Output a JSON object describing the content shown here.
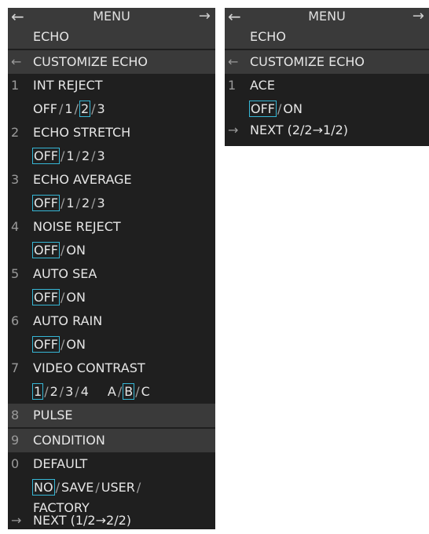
{
  "left": {
    "title": "MENU",
    "back_arrow": "←",
    "forward_arrow": "→",
    "section": "ECHO",
    "sub_back": "←",
    "sub_title": "CUSTOMIZE ECHO",
    "items": [
      {
        "num": "1",
        "label": "INT REJECT"
      },
      {
        "num": "2",
        "label": "ECHO STRETCH"
      },
      {
        "num": "3",
        "label": "ECHO AVERAGE"
      },
      {
        "num": "4",
        "label": "NOISE REJECT"
      },
      {
        "num": "5",
        "label": "AUTO SEA"
      },
      {
        "num": "6",
        "label": "AUTO RAIN"
      },
      {
        "num": "7",
        "label": "VIDEO CONTRAST"
      },
      {
        "num": "8",
        "label": "PULSE"
      },
      {
        "num": "9",
        "label": "CONDITION"
      },
      {
        "num": "0",
        "label": "DEFAULT"
      }
    ],
    "int_reject_options": [
      "OFF",
      "1",
      "2",
      "3"
    ],
    "echo_stretch_options": [
      "OFF",
      "1",
      "2",
      "3"
    ],
    "echo_average_options": [
      "OFF",
      "1",
      "2",
      "3"
    ],
    "noise_reject_options": [
      "OFF",
      "ON"
    ],
    "auto_sea_options": [
      "OFF",
      "ON"
    ],
    "auto_rain_options": [
      "OFF",
      "ON"
    ],
    "video_contrast_options_a": [
      "1",
      "2",
      "3",
      "4"
    ],
    "video_contrast_options_b": [
      "A",
      "B",
      "C"
    ],
    "default_options": [
      "NO",
      "SAVE",
      "USER",
      "FACTORY"
    ],
    "separator": "/",
    "next_arrow": "→",
    "next_label": "NEXT (1/2→2/2)"
  },
  "right": {
    "title": "MENU",
    "back_arrow": "←",
    "forward_arrow": "→",
    "section": "ECHO",
    "sub_back": "←",
    "sub_title": "CUSTOMIZE ECHO",
    "items": [
      {
        "num": "1",
        "label": "ACE"
      }
    ],
    "ace_options": [
      "OFF",
      "ON"
    ],
    "separator": "/",
    "next_arrow": "→",
    "next_label": "NEXT (2/2→1/2)"
  }
}
